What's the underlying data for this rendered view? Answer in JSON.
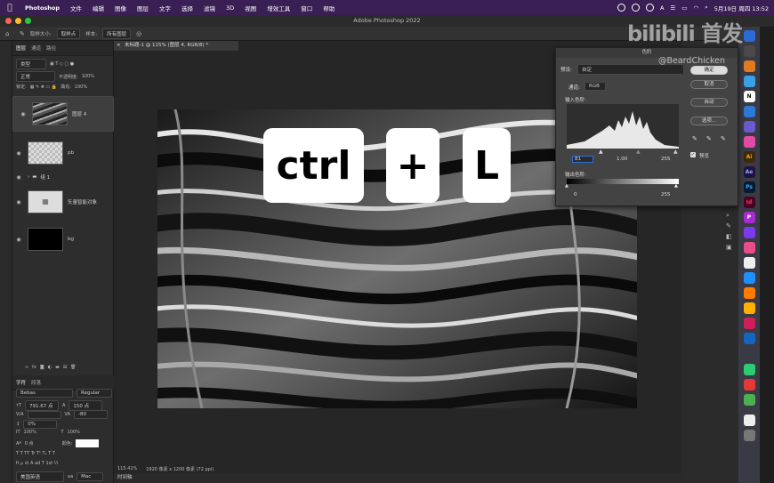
{
  "menubar": {
    "app": "Photoshop",
    "items": [
      "文件",
      "编辑",
      "图像",
      "图层",
      "文字",
      "选择",
      "滤镜",
      "3D",
      "视图",
      "增效工具",
      "窗口",
      "帮助"
    ],
    "datetime": "5月19日 周四  13:52"
  },
  "window": {
    "title": "Adobe Photoshop 2022"
  },
  "options": {
    "sample_size_label": "取样大小:",
    "sample_size": "取样点",
    "sample_label": "样本:",
    "sample": "所有图层"
  },
  "document": {
    "tab": "未标题-1 @ 115% (图层 4, RGB/8) *",
    "zoom": "115.41%",
    "info": "1920 像素 x 1200 像素 (72 ppi)"
  },
  "timeline": "时间轴",
  "layers_panel": {
    "tabs": [
      "图层",
      "通道",
      "路径"
    ],
    "kind": "类型",
    "blend": "正常",
    "opacity_label": "不透明度:",
    "opacity": "100%",
    "lock_label": "锁定:",
    "fill_label": "填充:",
    "fill": "100%",
    "layers": [
      {
        "name": "图层 4",
        "kind": "liquid"
      },
      {
        "name": "pb",
        "kind": "transparent"
      },
      {
        "name": "组 1",
        "kind": "group"
      },
      {
        "name": "矢量智能对象",
        "kind": "text"
      },
      {
        "name": "bg",
        "kind": "black"
      }
    ]
  },
  "character_panel": {
    "tabs": [
      "字符",
      "段落"
    ],
    "font": "Bebas",
    "style": "Regular",
    "size": "791.67 点",
    "leading": "150 点",
    "kerning": "",
    "tracking": "-80",
    "scale_v": "0%",
    "scale_h": "100%",
    "scale_v2": "100%",
    "baseline": "0 点",
    "color_label": "颜色:",
    "language": "美国英语",
    "aa": "Mac",
    "aa_prefix": "aa"
  },
  "overlay_keys": [
    "ctrl",
    "+",
    "L"
  ],
  "watermark": {
    "logo": "bilibili 首发",
    "handle": "@BeardChicken"
  },
  "levels_dialog": {
    "title": "色阶",
    "preset_label": "预设:",
    "preset": "自定",
    "channel_label": "通道:",
    "channel": "RGB",
    "input_label": "输入色阶:",
    "input_black": "81",
    "input_gamma": "1.00",
    "input_white": "255",
    "output_label": "输出色阶:",
    "output_black": "0",
    "output_white": "255",
    "buttons": {
      "ok": "确定",
      "cancel": "取消",
      "auto": "自动",
      "options": "选项..."
    },
    "preview_label": "预览"
  },
  "colors": {
    "menubar": "#3a1f55",
    "panel": "#2d2d2d",
    "dialog": "#434343",
    "accent_blue": "#2b6fd6"
  },
  "dock_apps": [
    "N",
    "Ai",
    "Ae",
    "Ps",
    "Id",
    "P"
  ]
}
